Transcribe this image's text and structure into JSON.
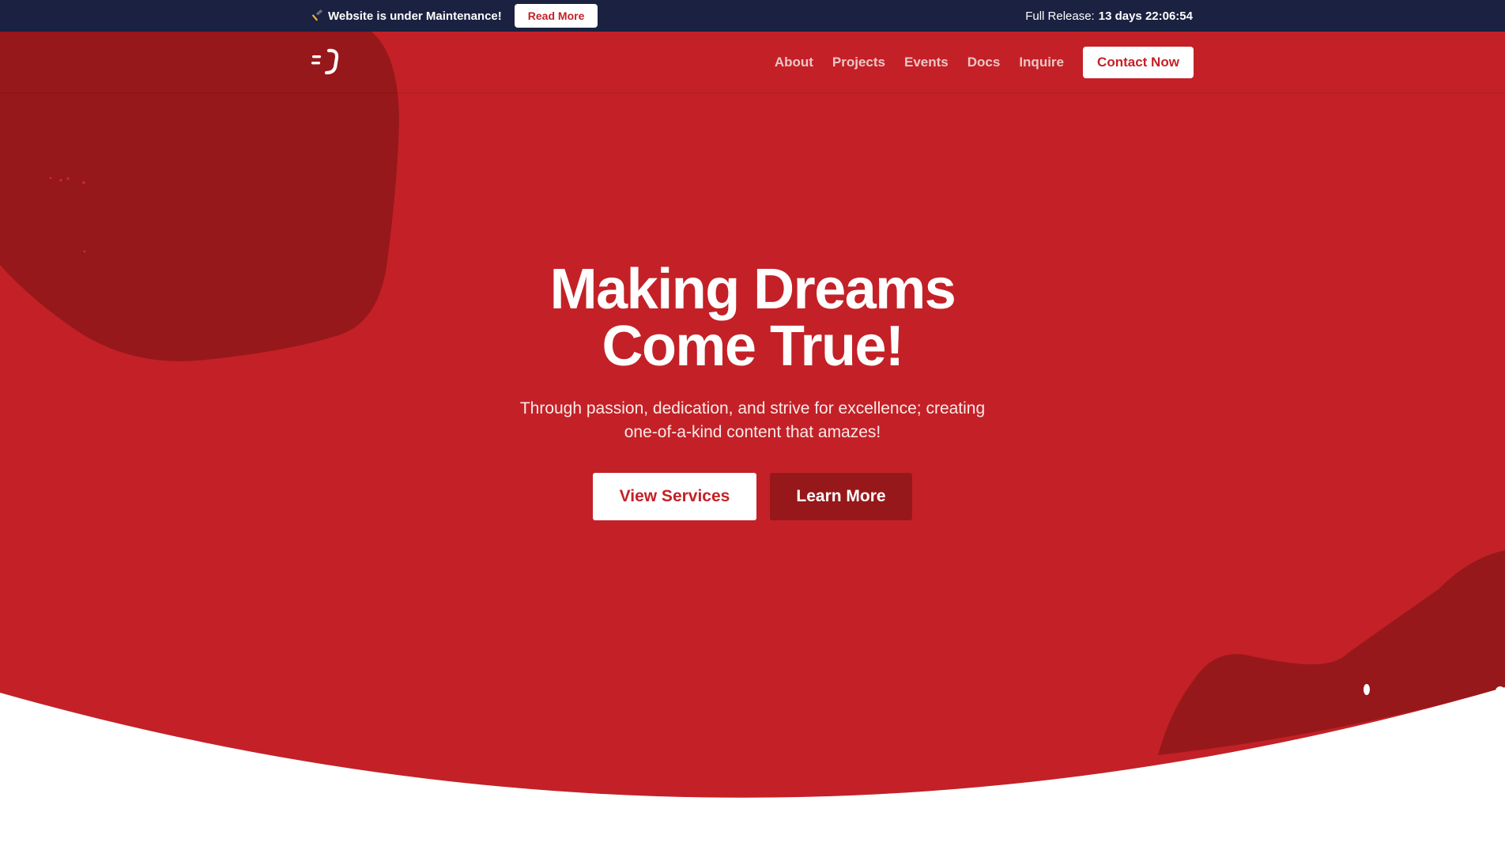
{
  "announcement": {
    "icon": "hammer-icon",
    "message": "Website is under Maintenance!",
    "read_more_label": "Read More",
    "release_label": "Full Release:",
    "release_countdown": "13 days 22:06:54"
  },
  "navbar": {
    "logo_text": "=)",
    "links": [
      "About",
      "Projects",
      "Events",
      "Docs",
      "Inquire"
    ],
    "contact_label": "Contact Now"
  },
  "hero": {
    "title": "Making Dreams Come True!",
    "subtitle": "Through passion, dedication, and strive for excellence; creating one-of-a-kind content that amazes!",
    "primary_button": "View Services",
    "secondary_button": "Learn More"
  },
  "colors": {
    "announcement_bg": "#1b2140",
    "hero_red": "#c32127",
    "blob_dark_red": "#97181a",
    "button_white": "#ffffff",
    "page_bg": "#ffffff"
  }
}
